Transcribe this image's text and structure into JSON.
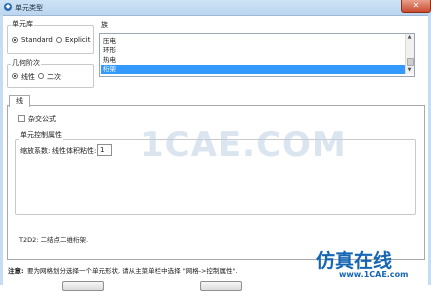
{
  "window": {
    "title": "单元类型",
    "close_glyph": "✕",
    "app_icon": "abaqus-icon"
  },
  "element_library": {
    "label": "单元库",
    "options": [
      {
        "label": "Standard",
        "selected": true
      },
      {
        "label": "Explicit",
        "selected": false
      }
    ]
  },
  "geometric_order": {
    "label": "几何阶次",
    "options": [
      {
        "label": "线性",
        "selected": true
      },
      {
        "label": "二次",
        "selected": false
      }
    ]
  },
  "family": {
    "label": "族",
    "items": [
      {
        "label": "压电",
        "selected": false
      },
      {
        "label": "环形",
        "selected": false
      },
      {
        "label": "热电",
        "selected": false
      },
      {
        "label": "桁架",
        "selected": true
      }
    ]
  },
  "tabs": [
    {
      "label": "线",
      "active": true
    }
  ],
  "hybrid_formulation": {
    "label": "杂交公式",
    "checked": false
  },
  "element_controls": {
    "label": "单元控制属性",
    "viscosity_label": "缩放系数:",
    "linear_bulk_label": "线性体积粘性:",
    "linear_bulk_value": "1"
  },
  "description": "T2D2:  二结点二维桁架.",
  "note": {
    "prefix": "注意:",
    "text": "要为网格划分选择一个单元形状, 请从主菜单栏中选择 \"网格->控制属性\"."
  },
  "watermarks": {
    "center": "1CAE.COM",
    "bottom_brand": "仿真在线",
    "bottom_url": "www.1CAE.com"
  },
  "colors": {
    "selection": "#3399ff",
    "titlebar": "#c9e0f5",
    "close": "#c94b2e",
    "watermark": "#1a6fb5"
  }
}
